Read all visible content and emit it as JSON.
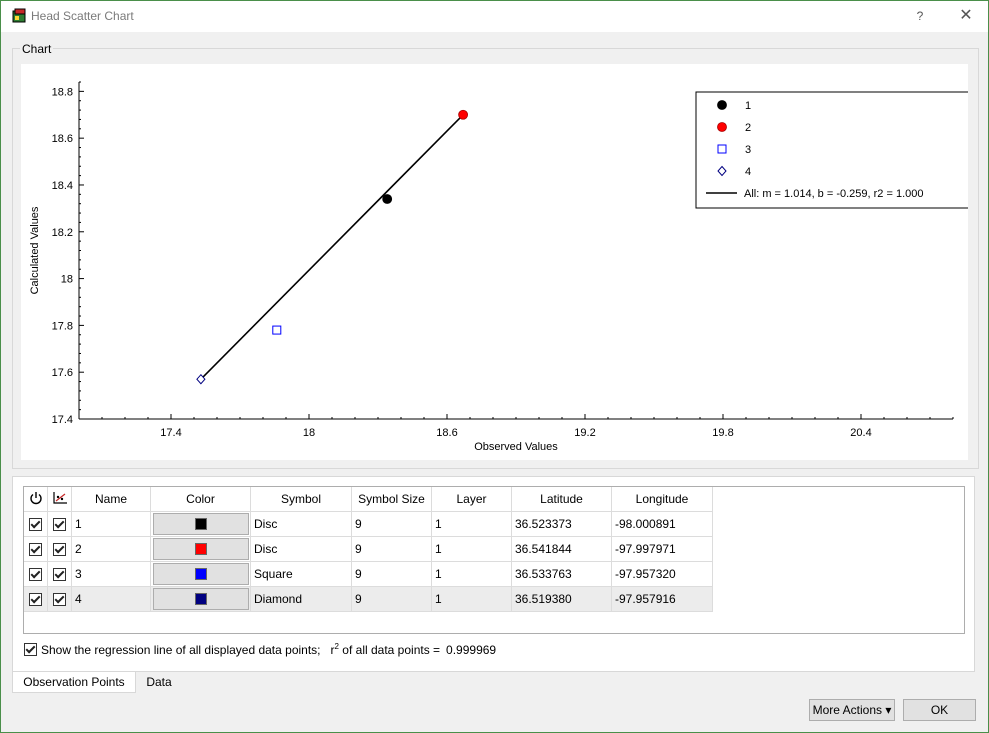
{
  "window": {
    "title": "Head Scatter Chart",
    "help_glyph": "?",
    "close_glyph": "✕"
  },
  "chart_group": {
    "label": "Chart"
  },
  "chart_data": {
    "type": "scatter",
    "xlabel": "Observed Values",
    "ylabel": "Calculated Values",
    "xlim": [
      17.0,
      20.8
    ],
    "ylim": [
      17.4,
      18.84
    ],
    "xticks": [
      "17.4",
      "18",
      "18.6",
      "19.2",
      "19.8",
      "20.4"
    ],
    "xtick_values": [
      17.4,
      18.0,
      18.6,
      19.2,
      19.8,
      20.4
    ],
    "yticks": [
      "17.4",
      "17.6",
      "17.8",
      "18",
      "18.2",
      "18.4",
      "18.6",
      "18.8"
    ],
    "ytick_values": [
      17.4,
      17.6,
      17.8,
      18.0,
      18.2,
      18.4,
      18.6,
      18.8
    ],
    "series": [
      {
        "name": "1",
        "symbol": "disc",
        "color": "#000000",
        "x": 18.34,
        "y": 18.34
      },
      {
        "name": "2",
        "symbol": "disc",
        "color": "#ff0000",
        "x": 18.67,
        "y": 18.7
      },
      {
        "name": "3",
        "symbol": "square",
        "color": "#0000ff",
        "x": 17.86,
        "y": 17.78
      },
      {
        "name": "4",
        "symbol": "diamond",
        "color": "#000080",
        "x": 17.53,
        "y": 17.57
      }
    ],
    "regression": {
      "label": "All: m = 1.014, b = -0.259, r2 = 1.000",
      "x": [
        17.53,
        18.67
      ],
      "y": [
        17.57,
        18.7
      ]
    },
    "legend_position": "top-right",
    "grid": false
  },
  "table": {
    "headers": {
      "name": "Name",
      "color": "Color",
      "symbol": "Symbol",
      "symbol_size": "Symbol Size",
      "layer": "Layer",
      "latitude": "Latitude",
      "longitude": "Longitude"
    },
    "header_icons": [
      "power-icon",
      "chart-icon"
    ],
    "rows": [
      {
        "show": true,
        "reg": true,
        "name": "1",
        "color": "#000000",
        "symbol": "Disc",
        "size": "9",
        "layer": "1",
        "lat": "36.523373",
        "lon": "-98.000891"
      },
      {
        "show": true,
        "reg": true,
        "name": "2",
        "color": "#ff0000",
        "symbol": "Disc",
        "size": "9",
        "layer": "1",
        "lat": "36.541844",
        "lon": "-97.997971"
      },
      {
        "show": true,
        "reg": true,
        "name": "3",
        "color": "#0000ff",
        "symbol": "Square",
        "size": "9",
        "layer": "1",
        "lat": "36.533763",
        "lon": "-97.957320"
      },
      {
        "show": true,
        "reg": true,
        "name": "4",
        "color": "#000080",
        "symbol": "Diamond",
        "size": "9",
        "layer": "1",
        "lat": "36.519380",
        "lon": "-97.957916"
      }
    ]
  },
  "regression_option": {
    "checked": true,
    "label": "Show the regression line of all displayed data points;",
    "r_prefix": "r",
    "r_sup": "2",
    "r_suffix": " of all data points =",
    "r_value": "0.999969"
  },
  "tabs": [
    {
      "label": "Observation Points",
      "active": true
    },
    {
      "label": "Data",
      "active": false
    }
  ],
  "buttons": {
    "more_actions": "More Actions",
    "more_glyph": "▾",
    "ok": "OK"
  }
}
